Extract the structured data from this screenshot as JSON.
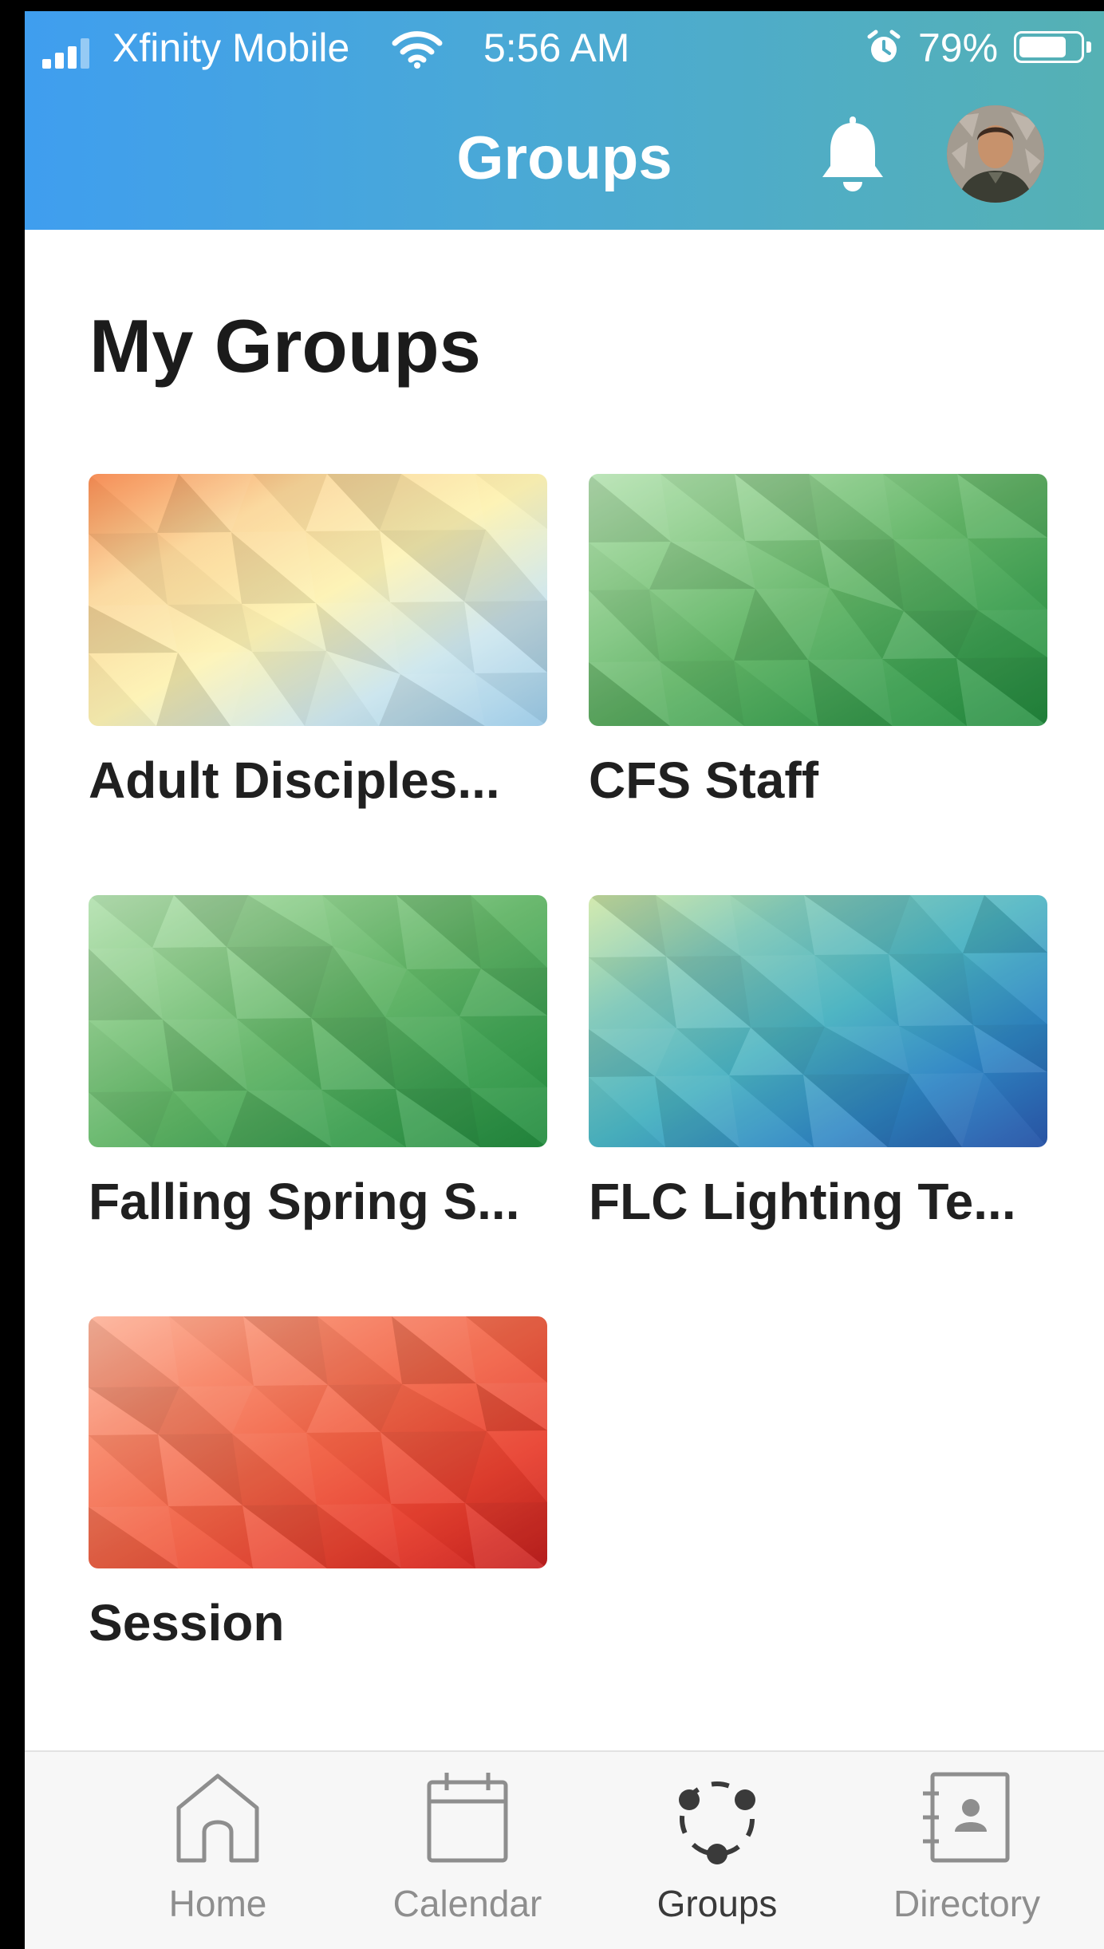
{
  "status_bar": {
    "carrier": "Xfinity Mobile",
    "time": "5:56 AM",
    "battery_percent": "79%",
    "battery_level": 0.79,
    "icons": [
      "signal-icon",
      "wifi-icon",
      "alarm-icon",
      "battery-icon"
    ]
  },
  "header": {
    "title": "Groups",
    "icons": [
      "bell-icon",
      "avatar"
    ]
  },
  "main": {
    "section_title": "My Groups",
    "groups": [
      {
        "name": "Adult Disciples...",
        "cover_colors": [
          "#f58a52",
          "#fbd79a",
          "#fdf3b4",
          "#cce6ee",
          "#9ac9e6"
        ]
      },
      {
        "name": "CFS Staff",
        "cover_colors": [
          "#b7e3b3",
          "#8fce8d",
          "#62b567",
          "#3ea052",
          "#238d3f"
        ]
      },
      {
        "name": "Falling Spring S...",
        "cover_colors": [
          "#b7e3b3",
          "#8fce8d",
          "#62b567",
          "#3ea052",
          "#238d3f"
        ]
      },
      {
        "name": "FLC Lighting Te...",
        "cover_colors": [
          "#cfe8a6",
          "#80c9b9",
          "#4ab3c2",
          "#2f86c5",
          "#2a55a8"
        ]
      },
      {
        "name": "Session",
        "cover_colors": [
          "#fdb59c",
          "#f8896b",
          "#f26447",
          "#e84130",
          "#c7201f"
        ]
      }
    ]
  },
  "tabbar": {
    "tabs": [
      {
        "label": "Home",
        "icon": "home-icon",
        "active": false
      },
      {
        "label": "Calendar",
        "icon": "calendar-icon",
        "active": false
      },
      {
        "label": "Groups",
        "icon": "groups-icon",
        "active": true
      },
      {
        "label": "Directory",
        "icon": "directory-icon",
        "active": false
      }
    ],
    "active_color": "#3a3a3a",
    "inactive_color": "#8e8e8e"
  }
}
